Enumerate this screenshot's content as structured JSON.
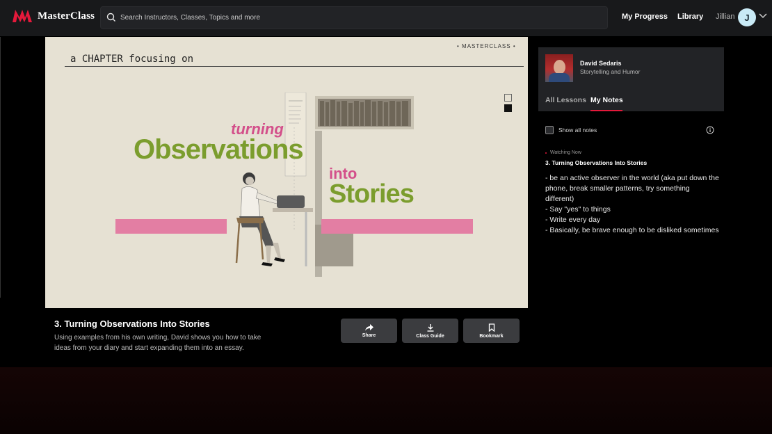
{
  "header": {
    "brand": "MasterClass",
    "search_placeholder": "Search Instructors, Classes, Topics and more",
    "nav": {
      "progress": "My Progress",
      "library": "Library"
    },
    "user": {
      "name": "Jillian",
      "initial": "J"
    }
  },
  "video": {
    "chapter_text": "a CHAPTER focusing on",
    "brand_mark": "• MASTERCLASS •",
    "title_turning": "turning",
    "title_observations": "Observations",
    "title_into": "into",
    "title_stories": "Stories"
  },
  "lesson": {
    "title": "3. Turning Observations Into Stories",
    "description": "Using examples from his own writing, David shows you how to take ideas from your diary and start expanding them into an essay."
  },
  "actions": {
    "share": "Share",
    "class_guide": "Class Guide",
    "bookmark": "Bookmark"
  },
  "panel": {
    "instructor_name": "David Sedaris",
    "course": "Storytelling and Humor",
    "tabs": {
      "all_lessons": "All Lessons",
      "my_notes": "My Notes"
    },
    "show_all_notes": "Show all notes",
    "watching_now": "Watching Now",
    "note_lesson": "3. Turning Observations Into Stories",
    "note_body": "- be an active observer in the world (aka put down the phone, break smaller patterns, try something different)\n- Say \"yes\" to things\n- Write every day\n- Basically, be brave enough to be disliked sometimes"
  },
  "colors": {
    "accent": "#e5193b",
    "green": "#7b9d2d",
    "pink": "#d34f8a"
  }
}
